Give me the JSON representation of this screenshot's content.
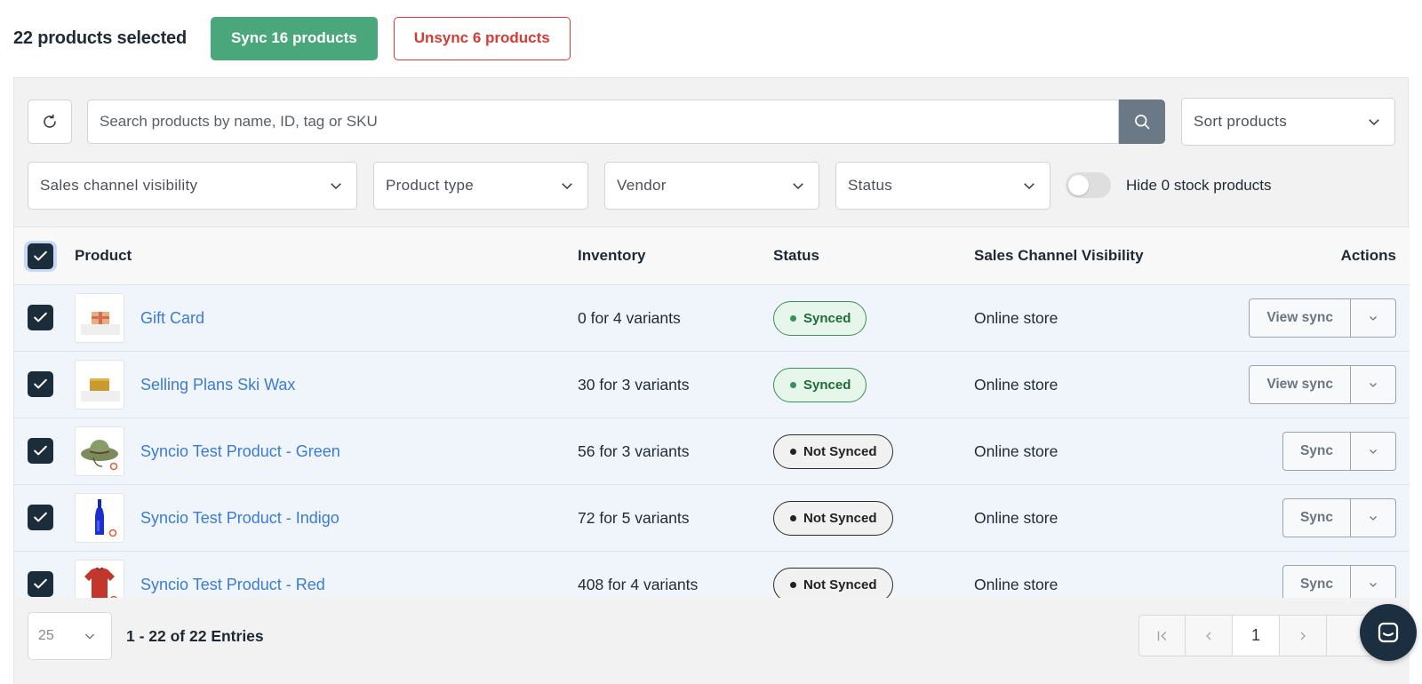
{
  "bulk": {
    "selected_text": "22 products selected",
    "sync_label": "Sync 16 products",
    "unsync_label": "Unsync 6 products"
  },
  "toolbar": {
    "search_placeholder": "Search products by name, ID, tag or SKU",
    "sort_placeholder": "Sort products",
    "filters": {
      "visibility": "Sales channel visibility",
      "type": "Product type",
      "vendor": "Vendor",
      "status": "Status"
    },
    "hide_zero_stock_label": "Hide 0 stock products",
    "hide_zero_stock_on": false
  },
  "table": {
    "headers": {
      "product": "Product",
      "inventory": "Inventory",
      "status": "Status",
      "visibility": "Sales Channel Visibility",
      "actions": "Actions"
    },
    "rows": [
      {
        "name": "Gift Card",
        "inventory": "0 for 4 variants",
        "status": "Synced",
        "visibility": "Online store",
        "action": "View sync",
        "thumb": "gift-card"
      },
      {
        "name": "Selling Plans Ski Wax",
        "inventory": "30 for 3 variants",
        "status": "Synced",
        "visibility": "Online store",
        "action": "View sync",
        "thumb": "ski-wax"
      },
      {
        "name": "Syncio Test Product - Green",
        "inventory": "56 for 3 variants",
        "status": "Not Synced",
        "visibility": "Online store",
        "action": "Sync",
        "thumb": "hat"
      },
      {
        "name": "Syncio Test Product - Indigo",
        "inventory": "72 for 5 variants",
        "status": "Not Synced",
        "visibility": "Online store",
        "action": "Sync",
        "thumb": "bottle"
      },
      {
        "name": "Syncio Test Product - Red",
        "inventory": "408 for 4 variants",
        "status": "Not Synced",
        "visibility": "Online store",
        "action": "Sync",
        "thumb": "tshirt"
      }
    ]
  },
  "footer": {
    "per_page": "25",
    "entries_text": "1 - 22 of 22 Entries",
    "current_page": "1"
  },
  "colors": {
    "sync_green": "#4aa77b",
    "unsync_red": "#d83a34",
    "link_blue": "#3a7bd5",
    "checkbox_navy": "#1b2c3b"
  }
}
